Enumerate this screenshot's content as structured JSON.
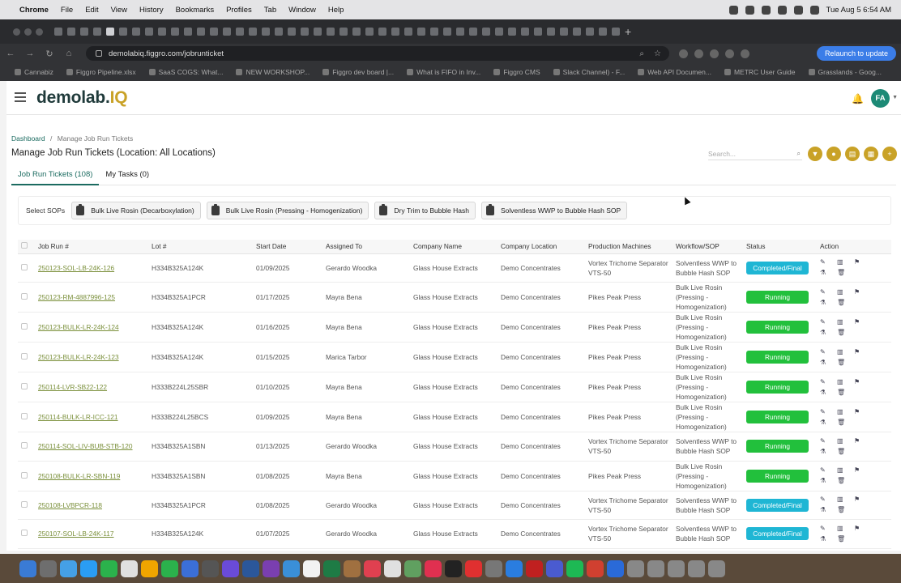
{
  "menubar": {
    "apple": "",
    "items": [
      "Chrome",
      "File",
      "Edit",
      "View",
      "History",
      "Bookmarks",
      "Profiles",
      "Tab",
      "Window",
      "Help"
    ],
    "datetime": "Tue Aug 5  6:54 AM"
  },
  "browser": {
    "url": "demolabiq.figgro.com/jobrunticket",
    "relaunch": "Relaunch to update",
    "bookmarks": [
      "Cannabiz",
      "Figgro Pipeline.xlsx",
      "SaaS COGS: What...",
      "NEW WORKSHOP...",
      "Figgro dev board |...",
      "What is FIFO in Inv...",
      "Figgro CMS",
      "Slack Channel) - F...",
      "Web API Documen...",
      "METRC User Guide",
      "Grasslands - Goog..."
    ]
  },
  "app": {
    "logo_main": "demolab.",
    "logo_accent": "IQ",
    "avatar": "FA"
  },
  "page": {
    "breadcrumb_home": "Dashboard",
    "breadcrumb_sep": "/",
    "breadcrumb_current": "Manage Job Run Tickets",
    "title": "Manage Job Run Tickets (Location: All Locations)",
    "search_placeholder": "Search...",
    "tabs": [
      "Job Run Tickets (108)",
      "My Tasks (0)"
    ],
    "sop_label": "Select SOPs",
    "sops": [
      "Bulk Live Rosin (Decarboxylation)",
      "Bulk Live Rosin (Pressing - Homogenization)",
      "Dry Trim to Bubble Hash",
      "Solventless WWP to Bubble Hash SOP"
    ]
  },
  "table": {
    "headers": [
      "Job Run #",
      "Lot #",
      "Start Date",
      "Assigned To",
      "Company Name",
      "Company Location",
      "Production Machines",
      "Workflow/SOP",
      "Status",
      "Action"
    ],
    "rows": [
      {
        "job": "250123-SOL-LB-24K-126",
        "lot": "H334B325A124K",
        "date": "01/09/2025",
        "assigned": "Gerardo Woodka",
        "company": "Glass House Extracts",
        "location": "Demo Concentrates",
        "machine": "Vortex Trichome Separator VTS-50",
        "sop": "Solventless WWP to Bubble Hash SOP",
        "status": "Completed/Final",
        "kind": "comp"
      },
      {
        "job": "250123-RM-4887996-125",
        "lot": "H334B325A1PCR",
        "date": "01/17/2025",
        "assigned": "Mayra Bena",
        "company": "Glass House Extracts",
        "location": "Demo Concentrates",
        "machine": "Pikes Peak Press",
        "sop": "Bulk Live Rosin (Pressing - Homogenization)",
        "status": "Running",
        "kind": "run"
      },
      {
        "job": "250123-BULK-LR-24K-124",
        "lot": "H334B325A124K",
        "date": "01/16/2025",
        "assigned": "Mayra Bena",
        "company": "Glass House Extracts",
        "location": "Demo Concentrates",
        "machine": "Pikes Peak Press",
        "sop": "Bulk Live Rosin (Pressing - Homogenization)",
        "status": "Running",
        "kind": "run"
      },
      {
        "job": "250123-BULK-LR-24K-123",
        "lot": "H334B325A124K",
        "date": "01/15/2025",
        "assigned": "Marica Tarbor",
        "company": "Glass House Extracts",
        "location": "Demo Concentrates",
        "machine": "Pikes Peak Press",
        "sop": "Bulk Live Rosin (Pressing - Homogenization)",
        "status": "Running",
        "kind": "run"
      },
      {
        "job": "250114-LVR-SB22-122",
        "lot": "H333B224L25SBR",
        "date": "01/10/2025",
        "assigned": "Mayra Bena",
        "company": "Glass House Extracts",
        "location": "Demo Concentrates",
        "machine": "Pikes Peak Press",
        "sop": "Bulk Live Rosin (Pressing - Homogenization)",
        "status": "Running",
        "kind": "run"
      },
      {
        "job": "250114-BULK-LR-ICC-121",
        "lot": "H333B224L25BCS",
        "date": "01/09/2025",
        "assigned": "Mayra Bena",
        "company": "Glass House Extracts",
        "location": "Demo Concentrates",
        "machine": "Pikes Peak Press",
        "sop": "Bulk Live Rosin (Pressing - Homogenization)",
        "status": "Running",
        "kind": "run"
      },
      {
        "job": "250114-SOL-LIV-BUB-STB-120",
        "lot": "H334B325A1SBN",
        "date": "01/13/2025",
        "assigned": "Gerardo Woodka",
        "company": "Glass House Extracts",
        "location": "Demo Concentrates",
        "machine": "Vortex Trichome Separator VTS-50",
        "sop": "Solventless WWP to Bubble Hash SOP",
        "status": "Running",
        "kind": "run"
      },
      {
        "job": "250108-BULK-LR-SBN-119",
        "lot": "H334B325A1SBN",
        "date": "01/08/2025",
        "assigned": "Mayra Bena",
        "company": "Glass House Extracts",
        "location": "Demo Concentrates",
        "machine": "Pikes Peak Press",
        "sop": "Bulk Live Rosin (Pressing - Homogenization)",
        "status": "Running",
        "kind": "run"
      },
      {
        "job": "250108-LVBPCR-118",
        "lot": "H334B325A1PCR",
        "date": "01/08/2025",
        "assigned": "Gerardo Woodka",
        "company": "Glass House Extracts",
        "location": "Demo Concentrates",
        "machine": "Vortex Trichome Separator VTS-50",
        "sop": "Solventless WWP to Bubble Hash SOP",
        "status": "Completed/Final",
        "kind": "comp"
      },
      {
        "job": "250107-SOL-LB-24K-117",
        "lot": "H334B325A124K",
        "date": "01/07/2025",
        "assigned": "Gerardo Woodka",
        "company": "Glass House Extracts",
        "location": "Demo Concentrates",
        "machine": "Vortex Trichome Separator VTS-50",
        "sop": "Solventless WWP to Bubble Hash SOP",
        "status": "Completed/Final",
        "kind": "comp"
      }
    ]
  },
  "colors": {
    "running": "#22c03c",
    "completed": "#1fb6d4",
    "accent": "#c9a227",
    "brand": "#1b6b60"
  },
  "icons": {
    "row_actions": [
      "edit-icon",
      "chart-icon",
      "flag-icon",
      "flask-icon",
      "trash-icon"
    ],
    "toolbar_actions": [
      "filter-icon",
      "location-icon",
      "export-icon",
      "calendar-icon",
      "add-icon"
    ]
  }
}
